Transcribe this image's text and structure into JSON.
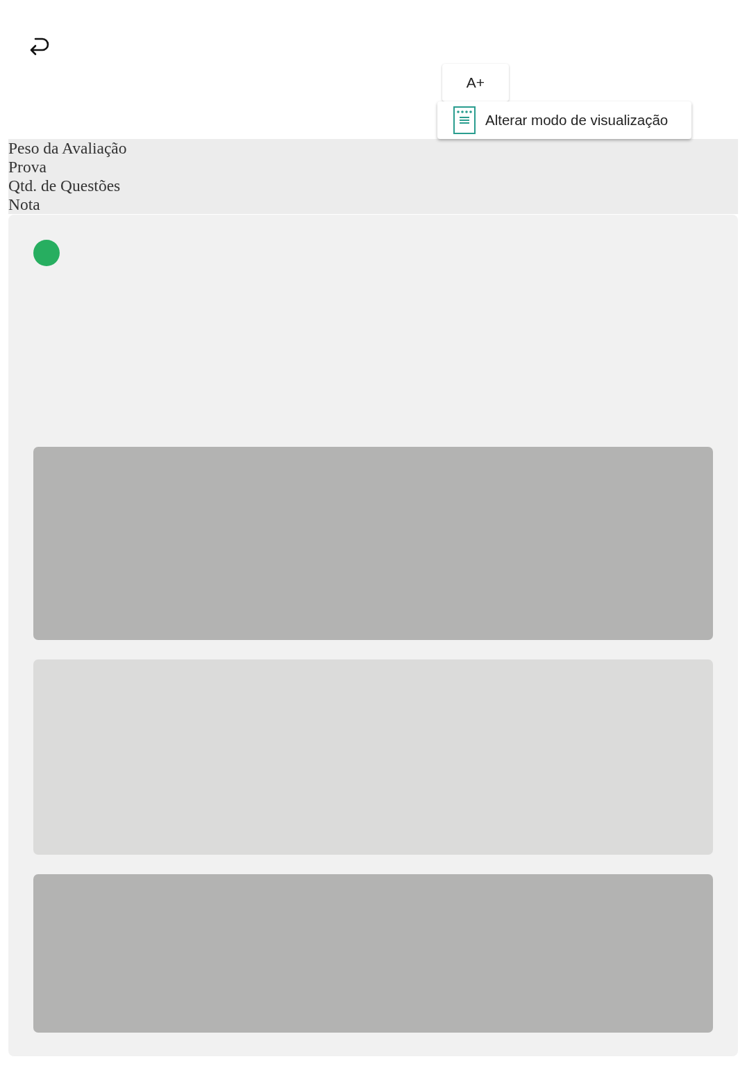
{
  "toolbar": {
    "font_button": "A+",
    "view_mode_button": "Alterar modo de visualização"
  },
  "header_labels": [
    "Peso da Avaliação",
    "Prova",
    "Qtd. de Questões",
    "Nota"
  ],
  "status_dot": {
    "color": "#27ae60"
  },
  "placeholders": [
    {
      "color": "#b3b3b2"
    },
    {
      "color": "#dbdbda"
    },
    {
      "color": "#b3b3b2"
    }
  ]
}
